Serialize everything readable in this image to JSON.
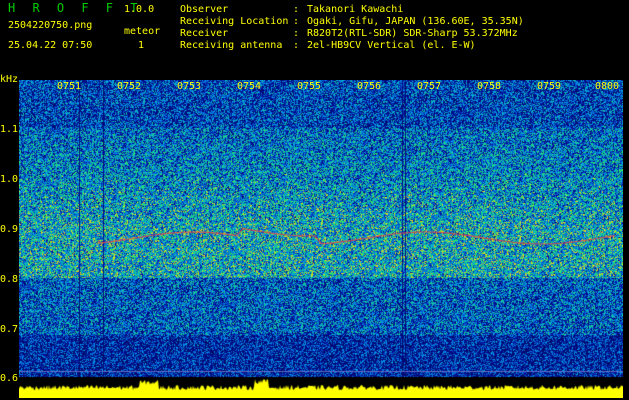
{
  "header": {
    "app_title": "H R O F F T",
    "version": "1.0.0",
    "file_name": "2504220750.png",
    "date_time": "25.04.22 07:50",
    "meteor_label": "meteor",
    "meteor_count": "1",
    "fields": [
      {
        "label": "Observer",
        "value": "Takanori Kawachi"
      },
      {
        "label": "Receiving Location",
        "value": "Ogaki, Gifu, JAPAN (136.60E, 35.35N)"
      },
      {
        "label": "Receiver",
        "value": "R820T2(RTL-SDR) SDR-Sharp 53.372MHz"
      },
      {
        "label": "Receiving antenna",
        "value": "2el-HB9CV Vertical (el. E-W)"
      }
    ]
  },
  "axis": {
    "unit": "kHz",
    "time_labels": [
      "0751",
      "0752",
      "0753",
      "0754",
      "0755",
      "0756",
      "0757",
      "0758",
      "0759",
      "0800"
    ],
    "freq_labels": [
      "1.1",
      "1.0",
      "0.9",
      "0.8",
      "0.7",
      "0.6"
    ]
  },
  "colors": {
    "text": "#ffff00",
    "title": "#00cc00",
    "background": "#000000",
    "spectrogram_low": "#0a1a8a",
    "spectrogram_high": "#ff2020",
    "power_trace": "#ffff00"
  }
}
